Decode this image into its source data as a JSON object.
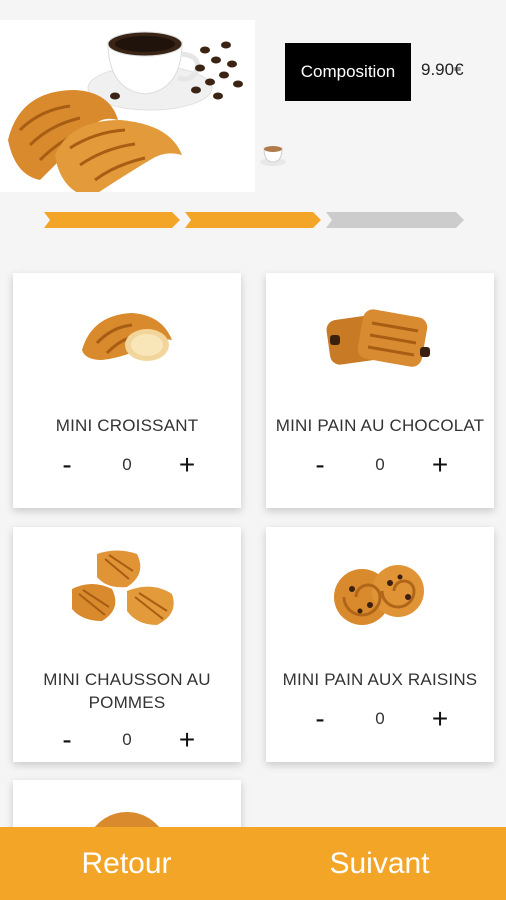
{
  "header": {
    "composition_label": "Composition",
    "price": "9.90€"
  },
  "progress": {
    "steps_total": 3,
    "steps_done": 2,
    "active_color": "#f3a528",
    "inactive_color": "#cccccc"
  },
  "products": [
    {
      "name": "MINI CROISSANT",
      "quantity": "0",
      "minus": "-",
      "plus": "+"
    },
    {
      "name": "MINI PAIN AU CHOCOLAT",
      "quantity": "0",
      "minus": "-",
      "plus": "+"
    },
    {
      "name_line1": "MINI CHAUSSON AU",
      "name_line2": "POMMES",
      "quantity": "0",
      "minus": "-",
      "plus": "+"
    },
    {
      "name": "MINI PAIN AUX RAISINS",
      "quantity": "0",
      "minus": "-",
      "plus": "+"
    }
  ],
  "footer": {
    "back_label": "Retour",
    "next_label": "Suivant",
    "color": "#f3a528"
  }
}
